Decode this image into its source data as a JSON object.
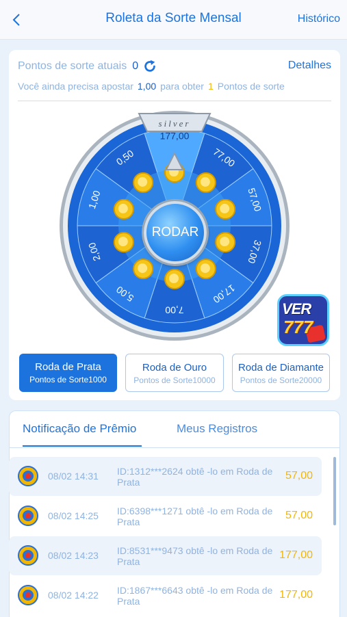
{
  "header": {
    "title": "Roleta da Sorte Mensal",
    "history_label": "Histórico"
  },
  "points": {
    "label": "Pontos de sorte atuais",
    "value": "0",
    "details_label": "Detalhes",
    "need_prefix": "Você ainda precisa apostar",
    "need_amount": "1,00",
    "need_middle": "para obter",
    "need_points": "1",
    "need_suffix": "Pontos de sorte"
  },
  "wheel": {
    "tier_label": "silver",
    "prizes": [
      "177,00",
      "77,00",
      "57,00",
      "37,00",
      "17,00",
      "7,00",
      "5,00",
      "2,00",
      "1,00",
      "0,50"
    ],
    "spin_label": "RODAR"
  },
  "wheel_tabs": [
    {
      "title": "Roda de Prata",
      "subtitle": "Pontos de Sorte1000",
      "active": true
    },
    {
      "title": "Roda de Ouro",
      "subtitle": "Pontos de Sorte10000",
      "active": false
    },
    {
      "title": "Roda de Diamante",
      "subtitle": "Pontos de Sorte20000",
      "active": false
    }
  ],
  "logo": {
    "text1": "VER",
    "text2": "777"
  },
  "records": {
    "tab_notifications": "Notificação de Prêmio",
    "tab_my_records": "Meus Registros",
    "rows": [
      {
        "time": "08/02 14:31",
        "desc": "ID:1312***2624 obtê -lo em Roda de Prata",
        "value": "57,00"
      },
      {
        "time": "08/02 14:25",
        "desc": "ID:6398***1271 obtê -lo em Roda de Prata",
        "value": "57,00"
      },
      {
        "time": "08/02 14:23",
        "desc": "ID:8531***9473 obtê -lo em Roda de Prata",
        "value": "177,00"
      },
      {
        "time": "08/02 14:22",
        "desc": "ID:1867***6643 obtê -lo em Roda de Prata",
        "value": "177,00"
      }
    ]
  },
  "colors": {
    "accent": "#1c73dd",
    "gold": "#f2b705",
    "muted": "#8fb3e0"
  }
}
